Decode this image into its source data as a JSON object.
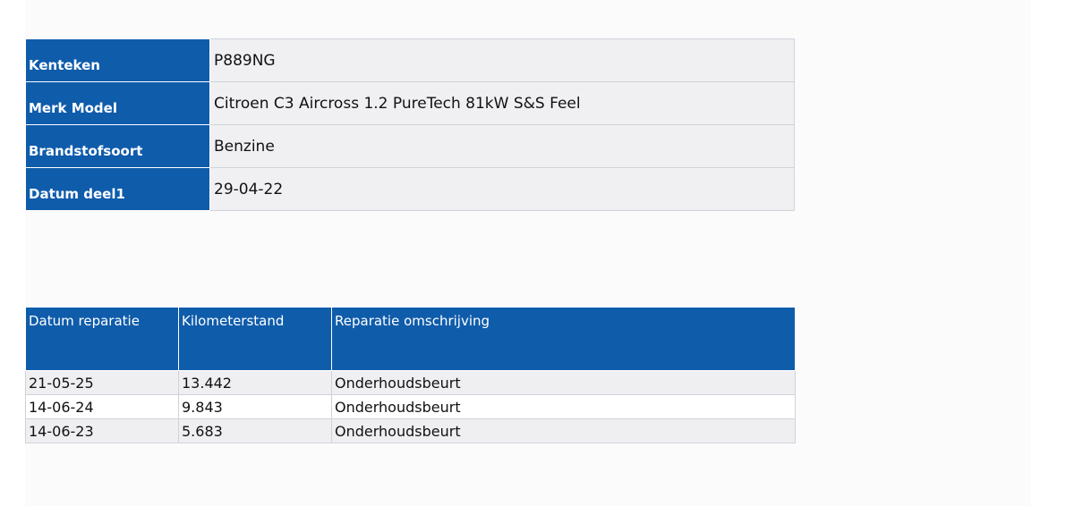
{
  "vehicle": {
    "rows": [
      {
        "label": "Kenteken",
        "value": "P889NG"
      },
      {
        "label": "Merk Model",
        "value": "Citroen C3 Aircross 1.2 PureTech 81kW S&S Feel"
      },
      {
        "label": "Brandstofsoort",
        "value": "Benzine"
      },
      {
        "label": "Datum deel1",
        "value": "29-04-22"
      }
    ]
  },
  "repairs": {
    "headers": [
      "Datum reparatie",
      "Kilometerstand",
      "Reparatie omschrijving"
    ],
    "rows": [
      {
        "date": "21-05-25",
        "km": "13.442",
        "description": "Onderhoudsbeurt"
      },
      {
        "date": "14-06-24",
        "km": "9.843",
        "description": "Onderhoudsbeurt"
      },
      {
        "date": "14-06-23",
        "km": "5.683",
        "description": "Onderhoudsbeurt"
      }
    ]
  },
  "colors": {
    "header_blue": "#0f5cab",
    "row_gray": "#efeff2",
    "border": "#cfd2d8"
  }
}
